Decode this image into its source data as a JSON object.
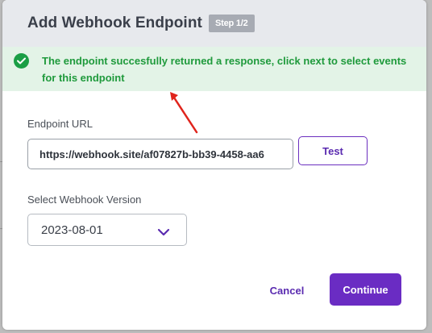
{
  "header": {
    "title": "Add Webhook Endpoint",
    "step_badge": "Step 1/2"
  },
  "banner": {
    "message": "The endpoint succesfully returned a response, click next to select events for this endpoint",
    "icon": "check-circle-icon",
    "color": "#1f9a3c"
  },
  "annotation": {
    "icon": "red-arrow-icon",
    "color": "#e0241c"
  },
  "endpoint": {
    "label": "Endpoint URL",
    "value": "https://webhook.site/af07827b-bb39-4458-aa6",
    "test_label": "Test"
  },
  "version": {
    "label": "Select Webhook Version",
    "selected": "2023-08-01",
    "icon": "chevron-down-icon"
  },
  "footer": {
    "cancel_label": "Cancel",
    "continue_label": "Continue"
  },
  "colors": {
    "accent": "#6a2cc3",
    "success_bg": "#e3f3e7",
    "header_bg": "#e7e9ed"
  }
}
